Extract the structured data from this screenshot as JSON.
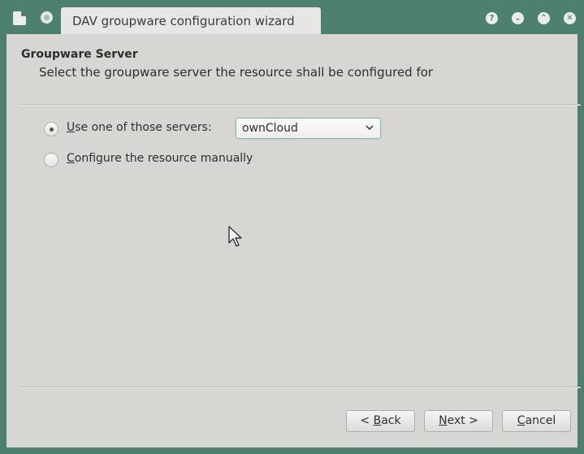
{
  "window": {
    "title": "DAV groupware configuration wizard",
    "controls": {
      "help": "?",
      "shade": "⌄",
      "minimize": "⌃",
      "close": "✕"
    }
  },
  "header": {
    "title": "Groupware Server",
    "subtitle": "Select the groupware server the resource shall be configured for"
  },
  "options": {
    "use_servers": {
      "label_mnemonic": "U",
      "label_rest": "se one of those servers:",
      "checked": true
    },
    "manual": {
      "label_mnemonic": "C",
      "label_rest": "onfigure the resource manually",
      "checked": false
    }
  },
  "server_select": {
    "value": "ownCloud"
  },
  "buttons": {
    "back": {
      "prefix": "< ",
      "mnemonic": "B",
      "rest": "ack"
    },
    "next": {
      "mnemonic": "N",
      "rest": "ext >"
    },
    "cancel": {
      "prefix": "",
      "mnemonic": "C",
      "rest": "ancel"
    }
  },
  "colors": {
    "titlebar": "#4e8070",
    "background": "#d8d6d3",
    "accent": "#8fb5a8"
  }
}
